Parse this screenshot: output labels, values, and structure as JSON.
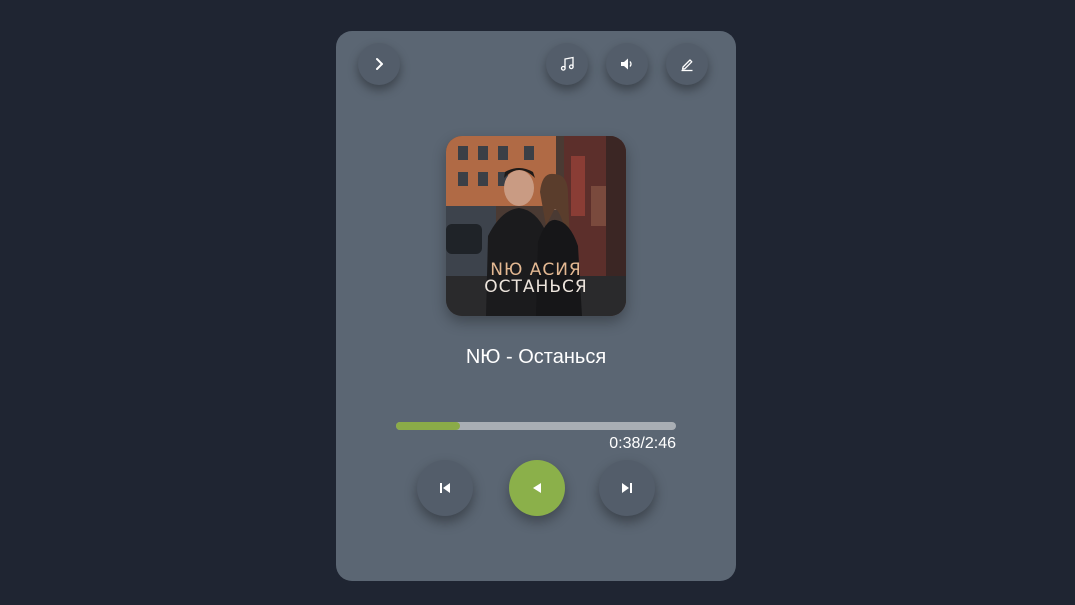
{
  "player": {
    "cover": {
      "artist_text": "NЮ  АСИЯ",
      "title_text": "ОСТАНЬСЯ"
    },
    "track_title": "NЮ - Останься",
    "progress": {
      "current": "0:38",
      "total": "2:46",
      "time_label": "0:38/2:46",
      "fraction": 0.229
    },
    "icons": {
      "top_left": "chevron-right-icon",
      "top_right": [
        "music-note-icon",
        "volume-icon",
        "edit-pencil-icon"
      ],
      "controls": [
        "skip-previous-icon",
        "play-icon",
        "skip-next-icon"
      ]
    },
    "colors": {
      "background": "#1f2532",
      "card": "#5b6673",
      "accent": "#8bb04a",
      "button": "#535d6a"
    }
  }
}
